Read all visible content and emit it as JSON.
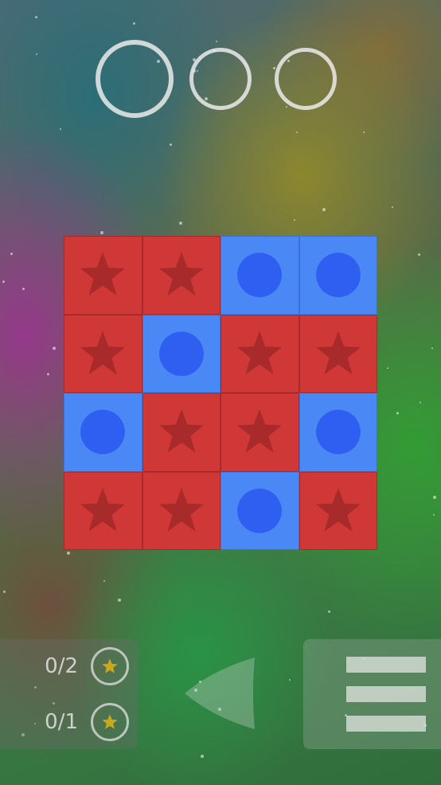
{
  "progress": {
    "total_moves": 3,
    "used": 0
  },
  "board": {
    "rows": [
      [
        "star",
        "star",
        "circle",
        "circle"
      ],
      [
        "star",
        "circle",
        "star",
        "star"
      ],
      [
        "circle",
        "star",
        "star",
        "circle"
      ],
      [
        "star",
        "star",
        "circle",
        "star"
      ]
    ],
    "colors": {
      "star_tile": "#d03838",
      "star_icon": "#a82a2a",
      "circle_tile": "#4a88f6",
      "circle_icon": "#2f5ff0"
    }
  },
  "counters": [
    {
      "label": "0/2",
      "icon": "star-icon"
    },
    {
      "label": "0/1",
      "icon": "star-icon"
    }
  ],
  "controls": {
    "back_icon": "triangle-left-icon",
    "menu_icon": "hamburger-menu-icon"
  },
  "star_badge_color": "#c8a81c"
}
